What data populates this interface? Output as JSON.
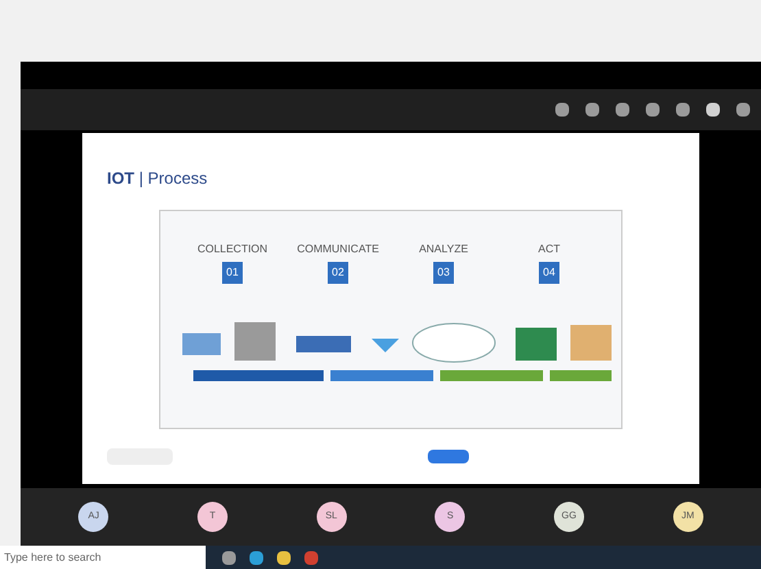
{
  "slide": {
    "title": "**IOT** | Process",
    "steps": [
      {
        "name": "COLLECTION",
        "number": "01"
      },
      {
        "name": "COMMUNICATE",
        "number": "02"
      },
      {
        "name": "ANALYZE",
        "number": "03"
      },
      {
        "name": "ACT",
        "number": "04"
      }
    ]
  },
  "participants": [
    {
      "initials": "AJ",
      "color": "#c9d6ee"
    },
    {
      "initials": "T",
      "color": "#f3c6d6"
    },
    {
      "initials": "SL",
      "color": "#f3c6d6"
    },
    {
      "initials": "S",
      "color": "#ecc6e4"
    },
    {
      "initials": "GG",
      "color": "#dfe3d8"
    },
    {
      "initials": "JM",
      "color": "#f2e1a6"
    }
  ],
  "taskbar": {
    "search_placeholder": "Type here to search"
  }
}
